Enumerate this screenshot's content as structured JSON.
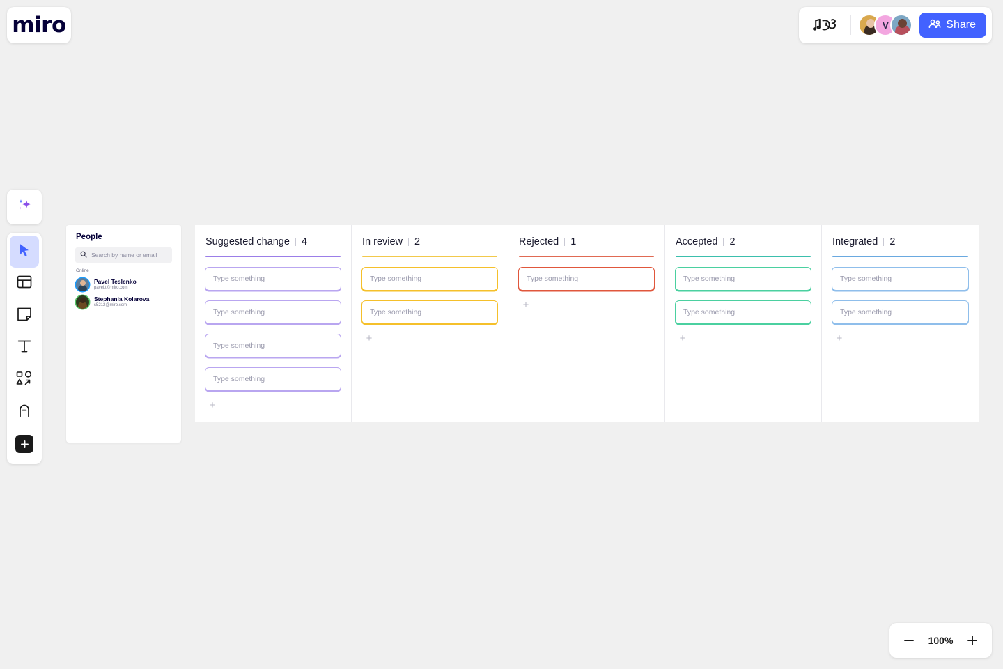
{
  "app": {
    "logo_text": "miro"
  },
  "topbar": {
    "doodle_icon": "music-doodle-icon",
    "collaborators": [
      {
        "name": "collaborator-1",
        "initial": ""
      },
      {
        "name": "collaborator-2",
        "initial": "V"
      },
      {
        "name": "collaborator-3",
        "initial": ""
      }
    ],
    "share_label": "Share",
    "share_color": "#4262FF"
  },
  "toolbar": {
    "ai_label": "AI",
    "items": [
      {
        "name": "select-tool",
        "label": "Select",
        "active": true
      },
      {
        "name": "templates-tool",
        "label": "Templates",
        "active": false
      },
      {
        "name": "sticky-note-tool",
        "label": "Sticky note",
        "active": false
      },
      {
        "name": "text-tool",
        "label": "Text",
        "active": false
      },
      {
        "name": "shapes-tool",
        "label": "Shapes",
        "active": false
      },
      {
        "name": "pen-tool",
        "label": "Pen",
        "active": false
      },
      {
        "name": "more-apps-tool",
        "label": "More apps",
        "active": false
      }
    ]
  },
  "people_panel": {
    "title": "People",
    "search": {
      "value": "",
      "placeholder": "Search by name or email"
    },
    "section_label": "Online",
    "people": [
      {
        "name": "Pavel Teslenko",
        "email": "pavel.t@miro.com",
        "ring": "#1A9BFC"
      },
      {
        "name": "Stephania Kolarova",
        "email": "s5212@miro.com",
        "ring": "#57C568"
      }
    ]
  },
  "board": {
    "columns": [
      {
        "title": "Suggested change",
        "count": "4",
        "accent": "#9B7EE8",
        "card_border": "#B9A6F0",
        "cards": [
          {
            "placeholder": "Type something"
          },
          {
            "placeholder": "Type something"
          },
          {
            "placeholder": "Type something"
          },
          {
            "placeholder": "Type something"
          }
        ],
        "add_label": "+"
      },
      {
        "title": "In review",
        "count": "2",
        "accent": "#F2C94C",
        "card_border": "#F5C02B",
        "cards": [
          {
            "placeholder": "Type something"
          },
          {
            "placeholder": "Type something"
          }
        ],
        "add_label": "+"
      },
      {
        "title": "Rejected",
        "count": "1",
        "accent": "#E06A54",
        "card_border": "#E0573C",
        "cards": [
          {
            "placeholder": "Type something"
          }
        ],
        "add_label": "+"
      },
      {
        "title": "Accepted",
        "count": "2",
        "accent": "#3BBFAD",
        "card_border": "#4BD0A0",
        "cards": [
          {
            "placeholder": "Type something"
          },
          {
            "placeholder": "Type something"
          }
        ],
        "add_label": "+"
      },
      {
        "title": "Integrated",
        "count": "2",
        "accent": "#6AA9E0",
        "card_border": "#8FBEEB",
        "cards": [
          {
            "placeholder": "Type something"
          },
          {
            "placeholder": "Type something"
          }
        ],
        "add_label": "+"
      }
    ]
  },
  "zoom": {
    "value": "100%",
    "minus_label": "−",
    "plus_label": "+"
  }
}
